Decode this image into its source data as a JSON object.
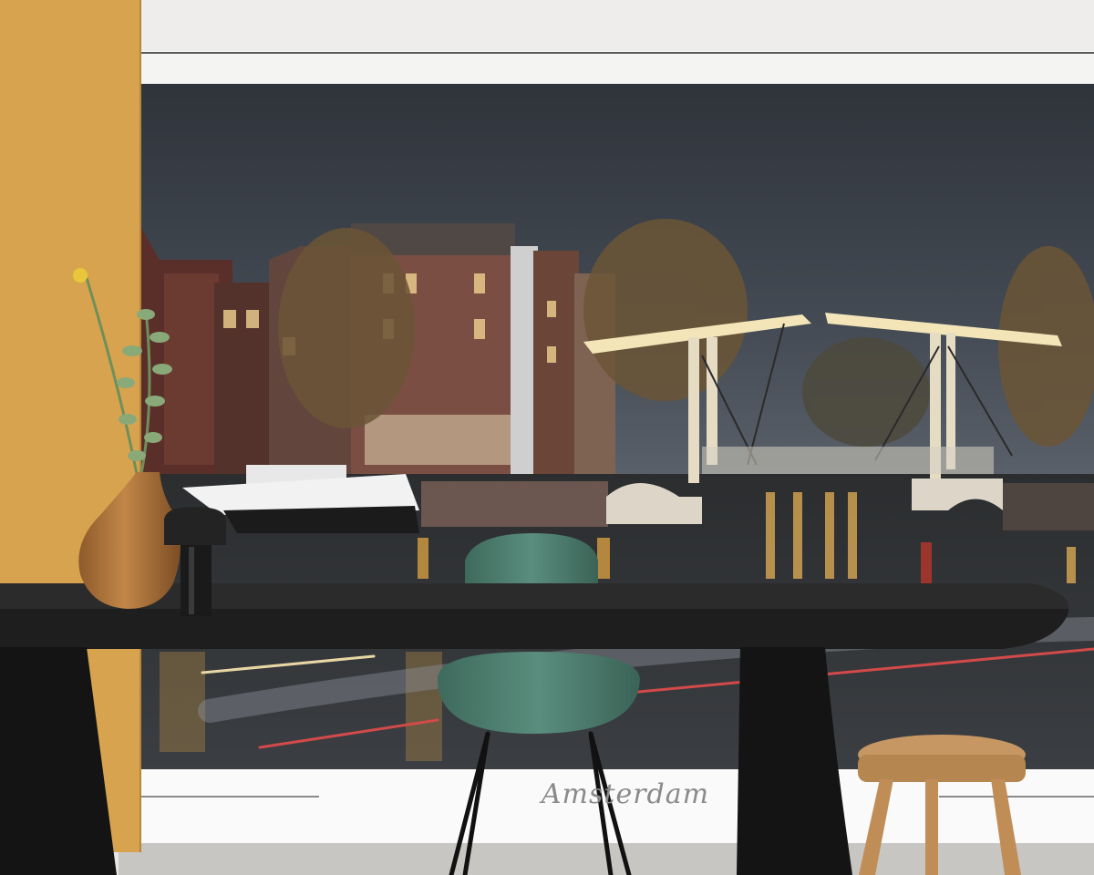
{
  "caption": {
    "text": "Amsterdam"
  },
  "colors": {
    "wall_ochre": "#d7a34f",
    "sky": "#3a4048",
    "canal_water": "#2c2f32",
    "table_top": "#1f1f20",
    "chair": "#4d7d6e",
    "stool_wood": "#c69763",
    "vase": "#b57a3e",
    "bridge_lights": "#f3e5b8"
  },
  "objects": {
    "wall": "ochre-wall",
    "mural": "amsterdam-canal-photo-mural",
    "table": "round-black-table",
    "chair": "green-shell-chair",
    "stool": "wooden-stool",
    "vase": "ceramic-vase-with-eucalyptus",
    "candle_holder": "black-candle-holder",
    "bridges": "lit-drawbridges"
  }
}
